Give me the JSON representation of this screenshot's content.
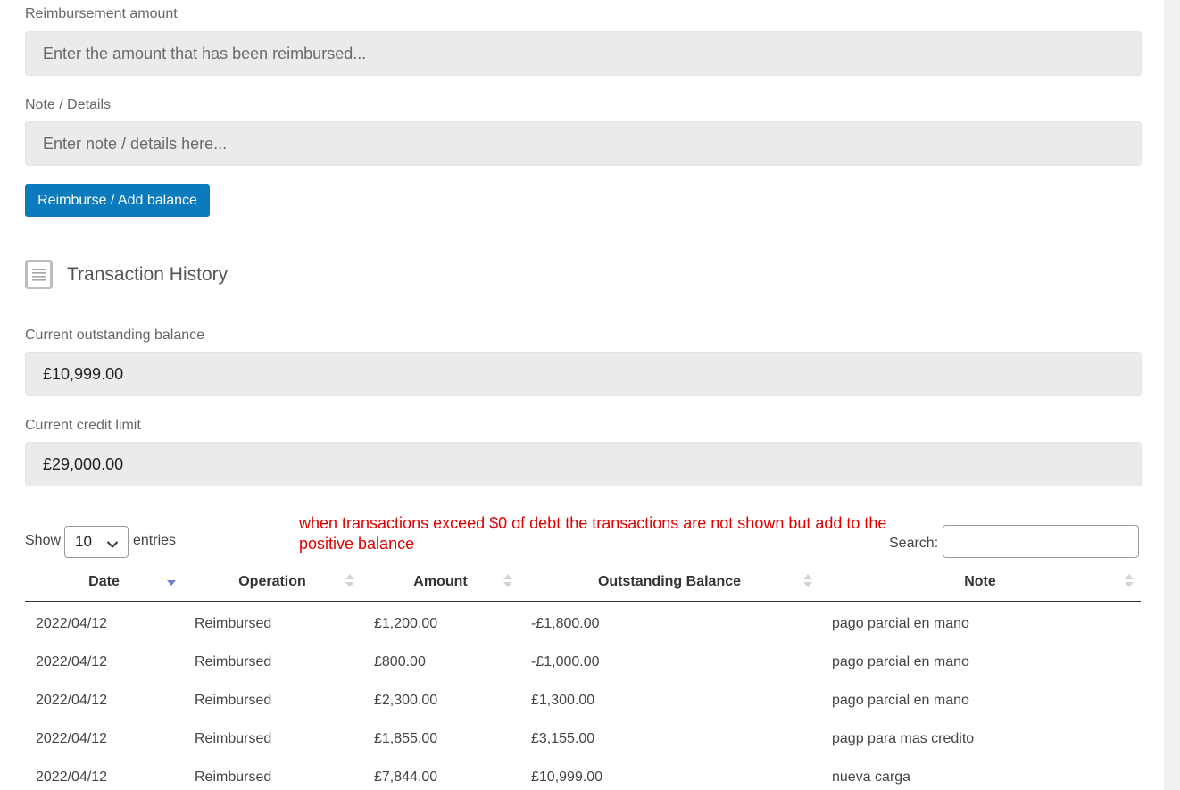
{
  "form": {
    "reimbursement_label": "Reimbursement amount",
    "reimbursement_placeholder": "Enter the amount that has been reimbursed...",
    "note_label": "Note / Details",
    "note_placeholder": "Enter note / details here...",
    "submit_label": "Reimburse / Add balance"
  },
  "history": {
    "title": "Transaction History",
    "icon": "document-icon",
    "balance_label": "Current outstanding balance",
    "balance_value": "£10,999.00",
    "credit_label": "Current credit limit",
    "credit_value": "£29,000.00"
  },
  "table_controls": {
    "show_label": "Show",
    "page_size": "10",
    "entries_label": "entries",
    "search_label": "Search:",
    "annotation": "when transactions exceed $0 of debt the transactions are not shown but add to the positive balance"
  },
  "table": {
    "headers": [
      "Date",
      "Operation",
      "Amount",
      "Outstanding Balance",
      "Note"
    ],
    "rows": [
      [
        "2022/04/12",
        "Reimbursed",
        "£1,200.00",
        "-£1,800.00",
        "pago parcial en mano"
      ],
      [
        "2022/04/12",
        "Reimbursed",
        "£800.00",
        "-£1,000.00",
        "pago parcial en mano"
      ],
      [
        "2022/04/12",
        "Reimbursed",
        "£2,300.00",
        "£1,300.00",
        "pago parcial en mano"
      ],
      [
        "2022/04/12",
        "Reimbursed",
        "£1,855.00",
        "£3,155.00",
        "pagp para mas credito"
      ],
      [
        "2022/04/12",
        "Reimbursed",
        "£7,844.00",
        "£10,999.00",
        "nueva carga"
      ]
    ]
  },
  "colors": {
    "primary_button": "#0b7bbd",
    "annotation_text": "#e00000",
    "field_background": "#ebebeb",
    "sort_active": "#6f7fd0"
  }
}
